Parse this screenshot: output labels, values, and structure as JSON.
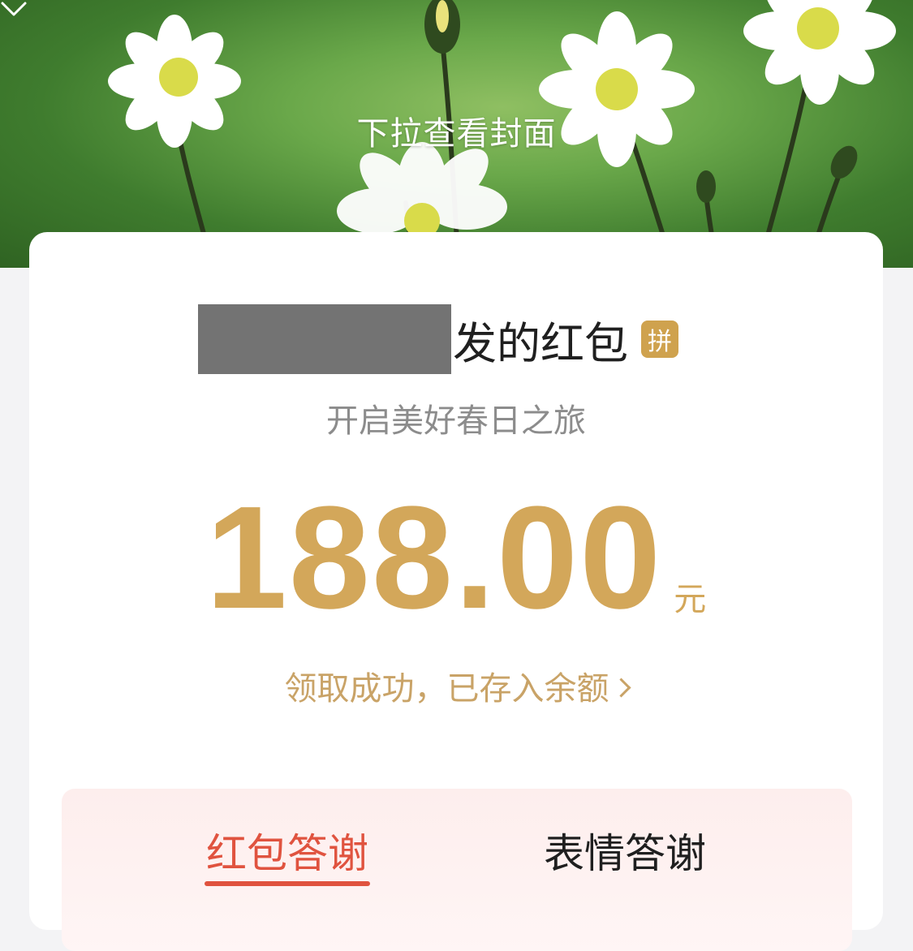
{
  "cover": {
    "pull_hint": "下拉查看封面"
  },
  "card": {
    "sender_suffix": "发的红包",
    "pin_badge": "拼",
    "blessing": "开启美好春日之旅",
    "amount": "188.00",
    "unit": "元",
    "status": "领取成功，已存入余额",
    "status_icon": "chevron-right-icon"
  },
  "thanks": {
    "tabs": [
      {
        "label": "红包答谢",
        "active": true
      },
      {
        "label": "表情答谢",
        "active": false
      }
    ]
  },
  "colors": {
    "accent_gold": "#d3a75a",
    "accent_red": "#e0533f",
    "cover_green": "#4f8f3a"
  }
}
